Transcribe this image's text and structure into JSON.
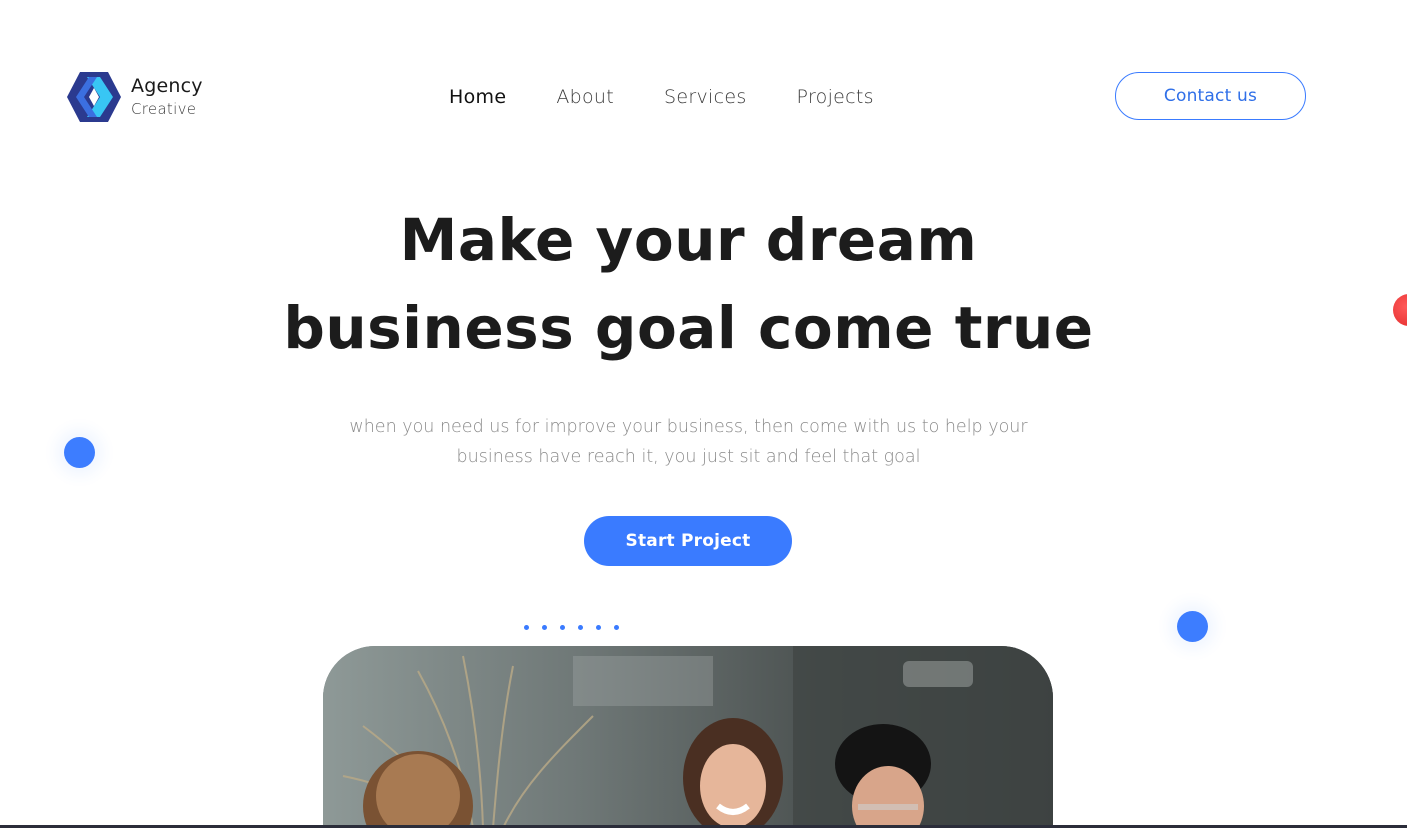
{
  "brand": {
    "title": "Agency",
    "subtitle": "Creative",
    "logo_icon": "hexagon-chevron-logo",
    "colors": {
      "logo_dark": "#2b3a8f",
      "logo_mid": "#3b6fe0",
      "logo_light": "#38c6f4"
    }
  },
  "nav": {
    "items": [
      {
        "label": "Home",
        "active": true
      },
      {
        "label": "About",
        "active": false
      },
      {
        "label": "Services",
        "active": false
      },
      {
        "label": "Projects",
        "active": false
      }
    ]
  },
  "header": {
    "contact_label": "Contact us"
  },
  "hero": {
    "title_line1": "Make your dream",
    "title_line2": "business goal come true",
    "description": "when you need us for improve your business, then come with us to help your business have reach it, you just sit and feel that goal",
    "cta_label": "Start Project",
    "image_alt_icon": "team-meeting-photo"
  },
  "colors": {
    "accent": "#3a7bff",
    "decor_blue": "#3d7dff",
    "decor_red": "#e83a3a",
    "heading": "#1c1c1c",
    "body_text": "#8a8a8a"
  }
}
